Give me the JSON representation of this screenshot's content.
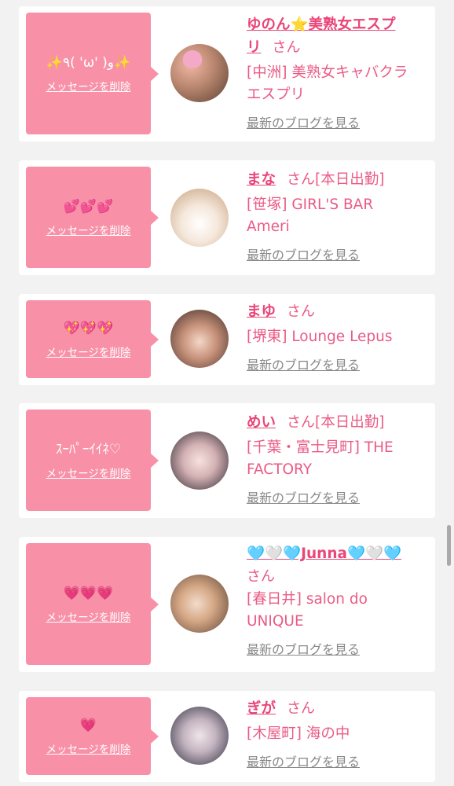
{
  "colors": {
    "accent": "#f891a8",
    "name": "#e9467a",
    "text": "#ea5b86",
    "link": "#888888"
  },
  "delete_label": "メッセージを削除",
  "blog_label": "最新のブログを見る",
  "cards": [
    {
      "message": "✨٩( 'ω' )و✨",
      "name_line1": "ゆのん⭐美熟女エスプ",
      "name_line2": "リ",
      "san": "さん",
      "status": "",
      "shop_line1": "[中洲] 美熟女キャバクラ",
      "shop_line2": "エスプリ"
    },
    {
      "message": "💕💕💕",
      "name": "まな",
      "san": "さん",
      "status": "[本日出勤]",
      "shop_line1": "[笹塚] GIRL'S BAR",
      "shop_line2": "Ameri"
    },
    {
      "message": "💖💖💖",
      "name": "まゆ",
      "san": "さん",
      "status": "",
      "shop_line1": "[堺東] Lounge Lepus",
      "shop_line2": ""
    },
    {
      "message": "ｽｰﾊﾟｰｲｲﾈ♡",
      "name": "めい",
      "san": "さん",
      "status": "[本日出勤]",
      "shop_line1": "[千葉・富士見町] THE",
      "shop_line2": "FACTORY"
    },
    {
      "message": "💗💗💗",
      "name": "🩵🤍🩵Junna🩵🤍🩵",
      "san": "さん",
      "status": "",
      "shop_line1": "[春日井] salon do",
      "shop_line2": "UNIQUE"
    },
    {
      "message": "💗",
      "name": "ぎが",
      "san": "さん",
      "status": "",
      "shop_line1": "[木屋町] 海の中",
      "shop_line2": ""
    }
  ]
}
